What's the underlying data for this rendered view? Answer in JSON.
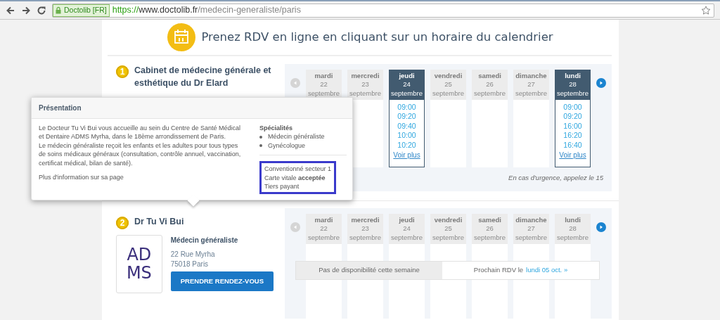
{
  "browser": {
    "site_badge": "Doctolib [FR]",
    "url_scheme": "https://",
    "url_host": "www.doctolib.fr",
    "url_path": "/medecin-generaliste/paris"
  },
  "heading": "Prenez RDV en ligne en cliquant sur un horaire du calendrier",
  "practices": [
    {
      "number": "1",
      "name": "Cabinet de médecine générale et esthétique du Dr Elard",
      "calendar": {
        "days": [
          {
            "day": "mardi",
            "date": "22",
            "month": "septembre",
            "selected": false
          },
          {
            "day": "mercredi",
            "date": "23",
            "month": "septembre",
            "selected": false
          },
          {
            "day": "jeudi",
            "date": "24",
            "month": "septembre",
            "selected": true,
            "slots": [
              "09:00",
              "09:20",
              "09:40",
              "10:00",
              "10:20"
            ],
            "more": "Voir plus"
          },
          {
            "day": "vendredi",
            "date": "25",
            "month": "septembre",
            "selected": false
          },
          {
            "day": "samedi",
            "date": "26",
            "month": "septembre",
            "selected": false
          },
          {
            "day": "dimanche",
            "date": "27",
            "month": "septembre",
            "selected": false
          },
          {
            "day": "lundi",
            "date": "28",
            "month": "septembre",
            "selected": true,
            "slots": [
              "09:00",
              "09:20",
              "16:00",
              "16:20",
              "16:40"
            ],
            "more": "Voir plus"
          }
        ],
        "note": "En cas d'urgence, appelez le 15"
      }
    },
    {
      "number": "2",
      "name": "Dr Tu Vi Bui",
      "logo_lines": [
        "AD",
        "MS"
      ],
      "specialty": "Médecin généraliste",
      "address": [
        "22 Rue Myrha",
        "75018 Paris"
      ],
      "button": "PRENDRE RENDEZ-VOUS",
      "calendar": {
        "days": [
          {
            "day": "mardi",
            "date": "22",
            "month": "septembre",
            "selected": false
          },
          {
            "day": "mercredi",
            "date": "23",
            "month": "septembre",
            "selected": false
          },
          {
            "day": "jeudi",
            "date": "24",
            "month": "septembre",
            "selected": false
          },
          {
            "day": "vendredi",
            "date": "25",
            "month": "septembre",
            "selected": false
          },
          {
            "day": "samedi",
            "date": "26",
            "month": "septembre",
            "selected": false
          },
          {
            "day": "dimanche",
            "date": "27",
            "month": "septembre",
            "selected": false
          },
          {
            "day": "lundi",
            "date": "28",
            "month": "septembre",
            "selected": false
          }
        ],
        "availability": {
          "message": "Pas de disponibilité cette semaine",
          "next_label": "Prochain RDV le",
          "next_link": "lundi 05 oct. »"
        }
      }
    }
  ],
  "popover": {
    "title": "Présentation",
    "paragraphs": [
      "Le Docteur Tu Vi Bui vous accueille au sein du Centre de Santé Médical et Dentaire ADMS Myrha, dans le 18ème arrondissement de Paris.",
      "Le médecin généraliste reçoit les enfants et les adultes pour tous types de soins médicaux généraux (consultation, contrôle annuel, vaccination, certificat médical, bilan de santé)."
    ],
    "more_info": "Plus d'information sur sa page",
    "specialties_title": "Spécialités",
    "specialties": [
      "Médecin généraliste",
      "Gynécologue"
    ],
    "conventions": [
      "Conventionné secteur 1",
      "Carte vitale **acceptée**",
      "Tiers payant"
    ],
    "conventions_highlighted": true
  }
}
